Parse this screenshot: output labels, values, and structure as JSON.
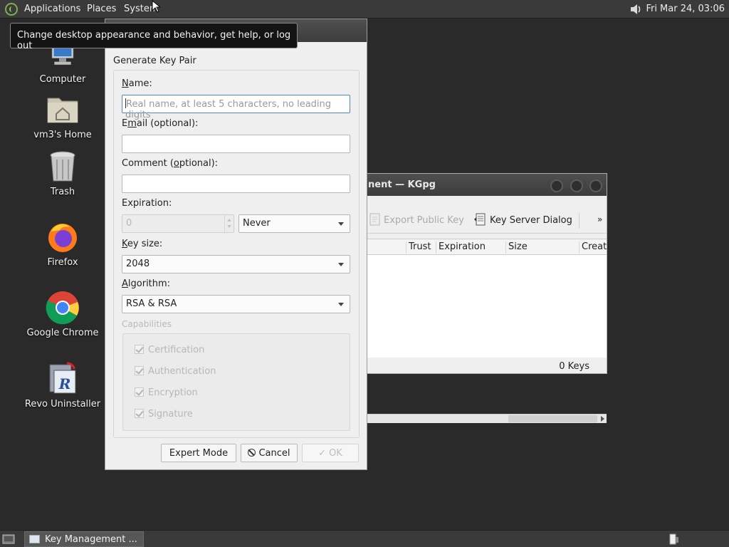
{
  "top_panel": {
    "menus": [
      "Applications",
      "Places",
      "System"
    ],
    "clock": "Fri Mar 24, 03:06"
  },
  "tooltip": "Change desktop appearance and behavior, get help, or log out",
  "desktop_icons": [
    {
      "label": "Computer"
    },
    {
      "label": "vm3's Home"
    },
    {
      "label": "Trash"
    },
    {
      "label": "Firefox"
    },
    {
      "label": "Google Chrome"
    },
    {
      "label": "Revo Uninstaller"
    }
  ],
  "kgpg_window": {
    "title": "nent — KGpg",
    "toolbar": {
      "export_label": "Export Public Key",
      "keyserver_label": "Key Server Dialog",
      "more": "»"
    },
    "columns": [
      "Trust",
      "Expiration",
      "Size",
      "Creati"
    ],
    "status": "0 Keys"
  },
  "dialog": {
    "group_title": "Generate Key Pair",
    "name_label": "Name:",
    "name_placeholder": "Real name, at least 5 characters, no leading digits",
    "email_label": "Email (optional):",
    "comment_label": "Comment (optional):",
    "expiration_label": "Expiration:",
    "expiration_value": "0",
    "expiration_unit": "Never",
    "keysize_label": "Key size:",
    "keysize_value": "2048",
    "algorithm_label": "Algorithm:",
    "algorithm_value": "RSA & RSA",
    "capabilities_label": "Capabilities",
    "capabilities": [
      "Certification",
      "Authentication",
      "Encryption",
      "Signature"
    ],
    "buttons": {
      "expert": "Expert Mode",
      "cancel": "Cancel",
      "ok": "OK"
    }
  },
  "taskbar": {
    "task_label": "Key Management ..."
  }
}
